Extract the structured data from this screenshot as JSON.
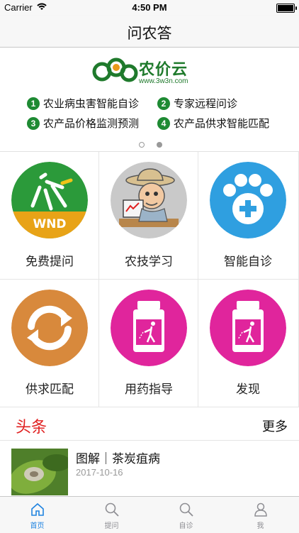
{
  "status_bar": {
    "carrier": "Carrier",
    "time": "4:50 PM"
  },
  "nav": {
    "title": "问农答"
  },
  "banner": {
    "logo_text": "农价云",
    "logo_url": "www.3w3n.com",
    "features": [
      {
        "num": "1",
        "text": "农业病虫害智能自诊"
      },
      {
        "num": "2",
        "text": "专家远程问诊"
      },
      {
        "num": "3",
        "text": "农产品价格监测预测"
      },
      {
        "num": "4",
        "text": "农产品供求智能匹配"
      }
    ],
    "page_count": 2,
    "active_page": 2
  },
  "grid": {
    "items": [
      {
        "label": "免费提问",
        "icon": "wnd-logo-icon"
      },
      {
        "label": "农技学习",
        "icon": "farmer-computer-icon"
      },
      {
        "label": "智能自诊",
        "icon": "paw-plus-icon"
      },
      {
        "label": "供求匹配",
        "icon": "exchange-arrows-icon"
      },
      {
        "label": "用药指导",
        "icon": "pesticide-bottle-icon"
      },
      {
        "label": "发现",
        "icon": "pesticide-bottle-icon"
      }
    ]
  },
  "headline": {
    "title": "头条",
    "more": "更多"
  },
  "news": [
    {
      "title": "图解｜茶炭疽病",
      "date": "2017-10-16"
    }
  ],
  "tabs": [
    {
      "label": "首页",
      "icon": "home-icon",
      "active": true
    },
    {
      "label": "提问",
      "icon": "search-icon",
      "active": false
    },
    {
      "label": "自诊",
      "icon": "search-icon",
      "active": false
    },
    {
      "label": "我",
      "icon": "person-icon",
      "active": false
    }
  ],
  "colors": {
    "accent_blue": "#1f83e0",
    "headline_red": "#e02020",
    "brand_green": "#1e8a33",
    "magenta": "#e0259c",
    "orange": "#d8893c",
    "sky_blue": "#2f9fe0"
  }
}
